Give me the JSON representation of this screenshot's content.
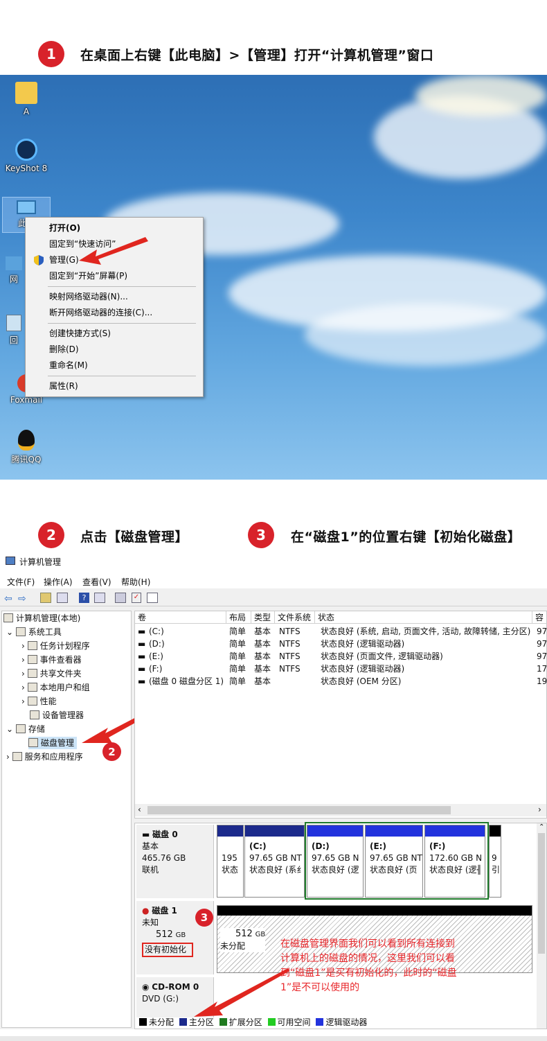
{
  "step1": {
    "num": "1",
    "text": "在桌面上右键【此电脑】>【管理】打开“计算机管理”窗口"
  },
  "desktop": {
    "icons": [
      {
        "label": "A",
        "icon": "user-folder-icon"
      },
      {
        "label": "KeyShot 8",
        "icon": "keyshot-icon"
      },
      {
        "label": "此电",
        "icon": "this-pc-icon"
      },
      {
        "label": "网",
        "icon": "network-icon"
      },
      {
        "label": "回",
        "icon": "recycle-bin-icon"
      },
      {
        "label": "Foxmail",
        "icon": "foxmail-icon"
      },
      {
        "label": "腾讯QQ",
        "icon": "qq-icon"
      }
    ],
    "context_menu": [
      "打开(O)",
      "固定到“快速访问”",
      "管理(G)",
      "固定到“开始”屏幕(P)",
      "映射网络驱动器(N)...",
      "断开网络驱动器的连接(C)...",
      "创建快捷方式(S)",
      "删除(D)",
      "重命名(M)",
      "属性(R)"
    ]
  },
  "step2": {
    "num": "2",
    "text": "点击【磁盘管理】"
  },
  "step3": {
    "num": "3",
    "text": "在“磁盘1”的位置右键【初始化磁盘】"
  },
  "cm": {
    "title": "计算机管理",
    "menu": [
      "文件(F)",
      "操作(A)",
      "查看(V)",
      "帮助(H)"
    ],
    "tree": {
      "root": "计算机管理(本地)",
      "sys": "系统工具",
      "task": "任务计划程序",
      "event": "事件查看器",
      "share": "共享文件夹",
      "users": "本地用户和组",
      "perf": "性能",
      "dev": "设备管理器",
      "storage": "存储",
      "disk": "磁盘管理",
      "svc": "服务和应用程序"
    },
    "columns": [
      "卷",
      "布局",
      "类型",
      "文件系统",
      "状态",
      "容"
    ],
    "volumes": [
      {
        "v": "(C:)",
        "l": "简单",
        "t": "基本",
        "fs": "NTFS",
        "s": "状态良好 (系统, 启动, 页面文件, 活动, 故障转储, 主分区)",
        "c": "97"
      },
      {
        "v": "(D:)",
        "l": "简单",
        "t": "基本",
        "fs": "NTFS",
        "s": "状态良好 (逻辑驱动器)",
        "c": "97"
      },
      {
        "v": "(E:)",
        "l": "简单",
        "t": "基本",
        "fs": "NTFS",
        "s": "状态良好 (页面文件, 逻辑驱动器)",
        "c": "97"
      },
      {
        "v": "(F:)",
        "l": "简单",
        "t": "基本",
        "fs": "NTFS",
        "s": "状态良好 (逻辑驱动器)",
        "c": "17"
      },
      {
        "v": "(磁盘 0 磁盘分区 1)",
        "l": "简单",
        "t": "基本",
        "fs": "",
        "s": "状态良好 (OEM 分区)",
        "c": "19"
      }
    ],
    "disk0": {
      "name": "磁盘 0",
      "type": "基本",
      "size": "465.76 GB",
      "status": "联机",
      "parts": [
        {
          "l1": "",
          "l2": "195",
          "l3": "状态"
        },
        {
          "l1": "(C:)",
          "l2": "97.65 GB NT",
          "l3": "状态良好 (系纟"
        },
        {
          "l1": "(D:)",
          "l2": "97.65 GB N",
          "l3": "状态良好 (逻"
        },
        {
          "l1": "(E:)",
          "l2": "97.65 GB NT",
          "l3": "状态良好 (页［"
        },
        {
          "l1": "(F:)",
          "l2": "172.60 GB N",
          "l3": "状态良好 (逻╢"
        },
        {
          "l1": "",
          "l2": "9",
          "l3": "引"
        }
      ]
    },
    "disk1": {
      "name": "磁盘 1",
      "type": "未知",
      "size": "512",
      "unit": "GB",
      "status": "没有初始化",
      "part_size": "512",
      "part_unit": "GB",
      "part_status": "未分配"
    },
    "cdrom": {
      "name": "CD-ROM 0",
      "type": "DVD (G:)"
    },
    "legend": [
      "未分配",
      "主分区",
      "扩展分区",
      "可用空间",
      "逻辑驱动器"
    ],
    "callout_num": "3",
    "callout_num2": "2",
    "note": "在磁盘管理界面我们可以看到所有连接到计算机上的磁盘的情况，这里我们可以看到“磁盘1”是买有初始化的，此时的“磁盘1”是不可以使用的"
  },
  "colors": {
    "accent": "#d8222a",
    "legend": [
      "#000000",
      "#1c2a8c",
      "#1f7a1f",
      "#22cc22",
      "#2233dd"
    ]
  }
}
